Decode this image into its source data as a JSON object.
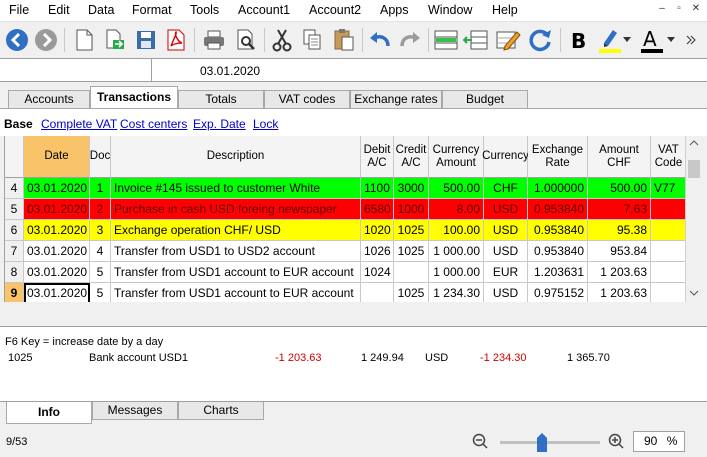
{
  "menu": [
    "File",
    "Edit",
    "Data",
    "Format",
    "Tools",
    "Account1",
    "Account2",
    "Apps",
    "Window",
    "Help"
  ],
  "window_buttons": {
    "minimize": "–",
    "restore": "▫",
    "close": "✕"
  },
  "cellbar": {
    "ref": "",
    "value": "03.01.2020"
  },
  "tabs": [
    "Accounts",
    "Transactions",
    "Totals",
    "VAT codes",
    "Exchange rates",
    "Budget"
  ],
  "active_tab": "Transactions",
  "views": [
    "Base",
    "Complete VAT",
    "Cost centers",
    "Exp. Date",
    "Lock"
  ],
  "columns": {
    "date": "Date",
    "doc": "Doc",
    "desc": "Description",
    "debit": "Debit A/C",
    "credit": "Credit A/C",
    "camount": "Currency Amount",
    "currency": "Currency",
    "rate": "Exchange Rate",
    "amount": "Amount CHF",
    "vat": "VAT Code"
  },
  "rows": [
    {
      "n": "4",
      "date": "03.01.2020",
      "doc": "1",
      "desc": "Invoice #145 issued to customer White",
      "debit": "1100",
      "credit": "3000",
      "camount": "500.00",
      "currency": "CHF",
      "rate": "1.000000",
      "amount": "500.00",
      "vat": "V77"
    },
    {
      "n": "5",
      "date": "03.01.2020",
      "doc": "2",
      "desc": "Purchase in cash USD foreing newspaper",
      "debit": "6580",
      "credit": "1000",
      "camount": "8.00",
      "currency": "USD",
      "rate": "0.953840",
      "amount": "7.63",
      "vat": ""
    },
    {
      "n": "6",
      "date": "03.01.2020",
      "doc": "3",
      "desc": "Exchange operation CHF/ USD",
      "debit": "1020",
      "credit": "1025",
      "camount": "100.00",
      "currency": "USD",
      "rate": "0.953840",
      "amount": "95.38",
      "vat": ""
    },
    {
      "n": "7",
      "date": "03.01.2020",
      "doc": "4",
      "desc": "Transfer from USD1 to USD2 account",
      "debit": "1026",
      "credit": "1025",
      "camount": "1 000.00",
      "currency": "USD",
      "rate": "0.953840",
      "amount": "953.84",
      "vat": ""
    },
    {
      "n": "8",
      "date": "03.01.2020",
      "doc": "5",
      "desc": "Transfer from USD1 account to EUR account",
      "debit": "1024",
      "credit": "",
      "camount": "1 000.00",
      "currency": "EUR",
      "rate": "1.203631",
      "amount": "1 203.63",
      "vat": ""
    },
    {
      "n": "9",
      "date": "03.01.2020",
      "doc": "5",
      "desc": "Transfer from USD1 account to EUR account",
      "debit": "",
      "credit": "1025",
      "camount": "1 234.30",
      "currency": "USD",
      "rate": "0.975152",
      "amount": "1 203.63",
      "vat": ""
    }
  ],
  "row_colors": {
    "green": "#00ff00",
    "red": "#ff0000",
    "yellow": "#ffff00",
    "white": "#ffffff"
  },
  "info": {
    "hint": "F6 Key = increase date by a day",
    "account": "1025",
    "account_name": "Bank account USD1",
    "v1": "-1 203.63",
    "v2": "1 249.94",
    "currency": "USD",
    "v3": "-1 234.30",
    "v4": "1 365.70"
  },
  "bottom_tabs": [
    "Info",
    "Messages",
    "Charts"
  ],
  "status": {
    "position": "9/53",
    "zoom": "90",
    "zoom_unit": "%"
  }
}
